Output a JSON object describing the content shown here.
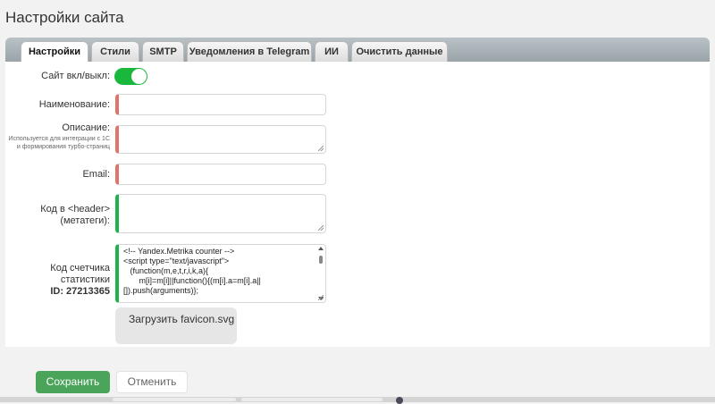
{
  "page": {
    "title": "Настройки сайта"
  },
  "tabs": [
    {
      "label": "Настройки",
      "active": true
    },
    {
      "label": "Стили",
      "active": false
    },
    {
      "label": "SMTP",
      "active": false
    },
    {
      "label": "Уведомления в Telegram",
      "active": false
    },
    {
      "label": "ИИ",
      "active": false
    },
    {
      "label": "Очистить данные",
      "active": false
    }
  ],
  "form": {
    "site_toggle": {
      "label": "Сайт вкл/выкл:",
      "on": true
    },
    "name": {
      "label": "Наименование:",
      "value": ""
    },
    "description": {
      "label": "Описание:",
      "hint": "Используется для интеграции с 1С и формирования турбо-страниц",
      "value": ""
    },
    "email": {
      "label": "Email:",
      "value": ""
    },
    "header_code": {
      "label": "Код в <header> (метатеги):",
      "value": ""
    },
    "stats_code": {
      "label": "Код счетчика статистики",
      "id_label": "ID: 27213365",
      "value": "<!-- Yandex.Metrika counter -->\n<script type=\"text/javascript\">\n   (function(m,e,t,r,i,k,a){\n       m[i]=m[i]||function(){(m[i].a=m[i].a||\n[]).push(arguments)};"
    },
    "upload_button": "Загрузить favicon.svg"
  },
  "actions": {
    "save": "Сохранить",
    "cancel": "Отменить"
  },
  "colors": {
    "required_marker": "#e0746b",
    "filled_marker": "#1fb24a",
    "toggle_on": "#19b83d",
    "save_button": "#4aa55a"
  }
}
